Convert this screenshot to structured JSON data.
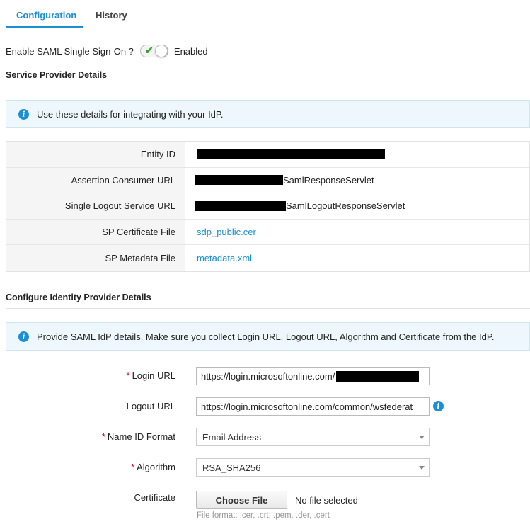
{
  "tabs": [
    {
      "label": "Configuration",
      "active": true
    },
    {
      "label": "History",
      "active": false
    }
  ],
  "sso": {
    "label": "Enable SAML Single Sign-On ?",
    "toggle_state": "Enabled",
    "enabled": true
  },
  "service_provider": {
    "title": "Service Provider Details",
    "info": "Use these details for integrating with your IdP.",
    "rows": [
      {
        "label": "Entity ID",
        "value": "",
        "redacted": true
      },
      {
        "label": "Assertion Consumer URL",
        "value": "SamlResponseServlet",
        "redacted": true
      },
      {
        "label": "Single Logout Service URL",
        "value": "SamlLogoutResponseServlet",
        "redacted": true
      },
      {
        "label": "SP Certificate File",
        "value": "sdp_public.cer",
        "link": true
      },
      {
        "label": "SP Metadata File",
        "value": "metadata.xml",
        "link": true
      }
    ]
  },
  "identity_provider": {
    "title": "Configure Identity Provider Details",
    "info": "Provide SAML IdP details. Make sure you collect Login URL, Logout URL, Algorithm and Certificate from the IdP.",
    "login_url": {
      "label": "Login URL",
      "required": "*",
      "value": "https://login.microsoftonline.com/"
    },
    "logout_url": {
      "label": "Logout URL",
      "value": "https://login.microsoftonline.com/common/wsfederat"
    },
    "name_id_format": {
      "label": "Name ID Format",
      "required": "*",
      "selected": "Email Address"
    },
    "algorithm": {
      "label": "Algorithm",
      "required": "*",
      "selected": "RSA_SHA256"
    },
    "certificate": {
      "label": "Certificate",
      "button": "Choose File",
      "status": "No file selected",
      "hint": "File format: .cer, .crt, .pem, .der, .cert"
    }
  },
  "colors": {
    "accent": "#1a8fd1",
    "required": "#d0021b",
    "info_bg": "#eef8fc",
    "toggle_check": "#2e9e2e"
  },
  "icons": {
    "info": "info-circle-icon",
    "check": "checkmark-icon",
    "caret": "chevron-down-icon"
  }
}
